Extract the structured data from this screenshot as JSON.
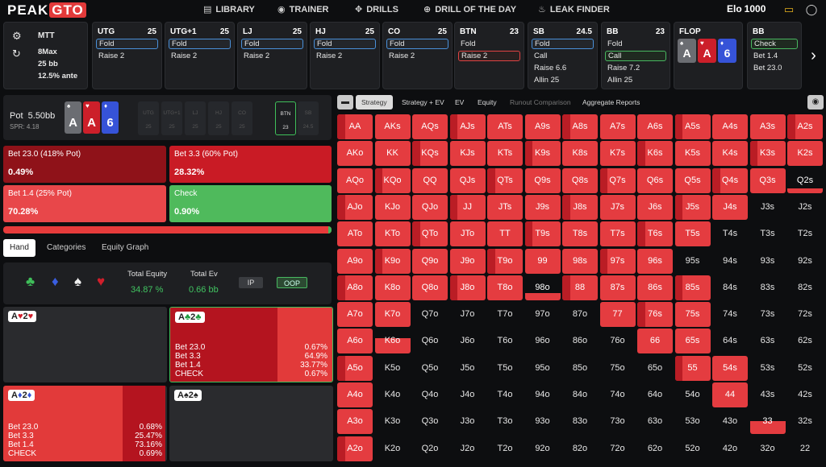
{
  "nav": {
    "logo_main": "PEAK",
    "logo_accent": "GTO",
    "items": [
      {
        "label": "LIBRARY",
        "icon": "book-icon"
      },
      {
        "label": "TRAINER",
        "icon": "gamepad-icon"
      },
      {
        "label": "DRILLS",
        "icon": "target-icon"
      },
      {
        "label": "DRILL OF THE DAY",
        "icon": "plus-circle-icon"
      },
      {
        "label": "LEAK FINDER",
        "icon": "flame-icon"
      }
    ],
    "elo_label": "Elo",
    "elo_value": "1000"
  },
  "settings": {
    "format": "MTT",
    "table": "8Max",
    "stack": "25 bb",
    "ante": "12.5% ante"
  },
  "positions": [
    {
      "name": "UTG",
      "stack": "25",
      "actions": [
        "Fold",
        "Raise 2"
      ],
      "selected": 0,
      "sel_color": "blue"
    },
    {
      "name": "UTG+1",
      "stack": "25",
      "actions": [
        "Fold",
        "Raise 2"
      ],
      "selected": 0,
      "sel_color": "blue"
    },
    {
      "name": "LJ",
      "stack": "25",
      "actions": [
        "Fold",
        "Raise 2"
      ],
      "selected": 0,
      "sel_color": "blue"
    },
    {
      "name": "HJ",
      "stack": "25",
      "actions": [
        "Fold",
        "Raise 2"
      ],
      "selected": 0,
      "sel_color": "blue"
    },
    {
      "name": "CO",
      "stack": "25",
      "actions": [
        "Fold",
        "Raise 2"
      ],
      "selected": 0,
      "sel_color": "blue"
    },
    {
      "name": "BTN",
      "stack": "23",
      "actions": [
        "Fold",
        "Raise 2"
      ],
      "selected": 1,
      "sel_color": "red"
    },
    {
      "name": "SB",
      "stack": "24.5",
      "actions": [
        "Fold",
        "Call",
        "Raise 6.6",
        "Allin 25"
      ],
      "selected": 0,
      "sel_color": "blue"
    },
    {
      "name": "BB",
      "stack": "23",
      "actions": [
        "Fold",
        "Call",
        "Raise 7.2",
        "Allin 25"
      ],
      "selected": 1,
      "sel_color": "green"
    }
  ],
  "flop": {
    "label": "FLOP",
    "cards": [
      {
        "rank": "A",
        "suit": "♠",
        "color": "gray"
      },
      {
        "rank": "A",
        "suit": "♥",
        "color": "red"
      },
      {
        "rank": "6",
        "suit": "♦",
        "color": "blue"
      }
    ]
  },
  "bb_node": {
    "name": "BB",
    "actions": [
      "Check",
      "Bet 1.4",
      "Bet 23.0"
    ]
  },
  "pot": {
    "label": "Pot",
    "value": "5.50bb",
    "spr": "SPR: 4.18"
  },
  "mini_positions": [
    {
      "name": "UTG",
      "stack": "25"
    },
    {
      "name": "UTG+1",
      "stack": "25"
    },
    {
      "name": "LJ",
      "stack": "25"
    },
    {
      "name": "HJ",
      "stack": "25"
    },
    {
      "name": "CO",
      "stack": "25"
    },
    {
      "name": "BTN",
      "stack": "23"
    },
    {
      "name": "SB",
      "stack": "24.5"
    }
  ],
  "strategy_blocks": [
    {
      "label": "Bet 23.0 (418% Pot)",
      "value": "0.49%",
      "color": "#8f1219"
    },
    {
      "label": "Bet 3.3 (60% Pot)",
      "value": "28.32%",
      "color": "#c91b25"
    },
    {
      "label": "Bet 1.4 (25% Pot)",
      "value": "70.28%",
      "color": "#e8474a"
    },
    {
      "label": "Check",
      "value": "0.90%",
      "color": "#4fba5c"
    }
  ],
  "left_tabs": [
    "Hand",
    "Categories",
    "Equity Graph"
  ],
  "equity": {
    "suits": [
      "♣",
      "♦",
      "♠",
      "♥"
    ],
    "total_equity_label": "Total Equity",
    "total_equity": "34.87 %",
    "total_ev_label": "Total Ev",
    "total_ev": "0.66 bb",
    "ip": "IP",
    "oop": "OOP"
  },
  "combos": [
    {
      "rank1": "A",
      "suit1": "♥",
      "rank2": "2",
      "suit2": "♥",
      "cls": "r",
      "lines": []
    },
    {
      "rank1": "A",
      "suit1": "♣",
      "rank2": "2",
      "suit2": "♣",
      "cls": "c",
      "lines": [
        [
          "Bet 23.0",
          "0.67%"
        ],
        [
          "Bet 3.3",
          "64.9%"
        ],
        [
          "Bet 1.4",
          "33.77%"
        ],
        [
          "CHECK",
          "0.67%"
        ]
      ]
    },
    {
      "rank1": "A",
      "suit1": "♦",
      "rank2": "2",
      "suit2": "♦",
      "cls": "b",
      "lines": [
        [
          "Bet 23.0",
          "0.68%"
        ],
        [
          "Bet 3.3",
          "25.47%"
        ],
        [
          "Bet 1.4",
          "73.16%"
        ],
        [
          "CHECK",
          "0.69%"
        ]
      ]
    },
    {
      "rank1": "A",
      "suit1": "♠",
      "rank2": "2",
      "suit2": "♠",
      "cls": "k",
      "lines": []
    }
  ],
  "right_tabs": [
    "Strategy",
    "Strategy + EV",
    "EV",
    "Equity",
    "Runout Comparison",
    "Aggregate Reports"
  ],
  "grid_fills": {
    "A": [
      1,
      1,
      1,
      1,
      1,
      1,
      1,
      1,
      1,
      1,
      1,
      1,
      1
    ],
    "K": [
      1,
      1,
      1,
      1,
      1,
      1,
      1,
      1,
      1,
      1,
      1,
      1,
      1
    ],
    "Q": [
      1,
      1,
      1,
      1,
      1,
      1,
      1,
      1,
      1,
      1,
      1,
      1,
      0.2
    ],
    "J": [
      1,
      1,
      1,
      1,
      1,
      1,
      1,
      1,
      1,
      1,
      1,
      0,
      0
    ],
    "T": [
      1,
      1,
      1,
      1,
      1,
      1,
      1,
      1,
      1,
      1,
      0,
      0,
      0
    ],
    "9": [
      1,
      1,
      1,
      1,
      1,
      1,
      1,
      1,
      1,
      0,
      0,
      0,
      0
    ],
    "8": [
      1,
      1,
      1,
      1,
      1,
      0.3,
      1,
      1,
      1,
      1,
      0,
      0,
      0
    ],
    "7": [
      1,
      1,
      0,
      0,
      0,
      0,
      0,
      1,
      1,
      1,
      0,
      0,
      0
    ],
    "6": [
      1,
      0.6,
      0,
      0,
      0,
      0,
      0,
      0,
      1,
      1,
      0,
      0,
      0
    ],
    "5": [
      1,
      0,
      0,
      0,
      0,
      0,
      0,
      0,
      0,
      1,
      1,
      0,
      0
    ],
    "4": [
      1,
      0,
      0,
      0,
      0,
      0,
      0,
      0,
      0,
      0,
      1,
      0,
      0
    ],
    "3": [
      1,
      0,
      0,
      0,
      0,
      0,
      0,
      0,
      0,
      0,
      0,
      0.5,
      0
    ],
    "2": [
      1,
      0,
      0,
      0,
      0,
      0,
      0,
      0,
      0,
      0,
      0,
      0,
      0
    ]
  },
  "grid_ranks": [
    "A",
    "K",
    "Q",
    "J",
    "T",
    "9",
    "8",
    "7",
    "6",
    "5",
    "4",
    "3",
    "2"
  ]
}
